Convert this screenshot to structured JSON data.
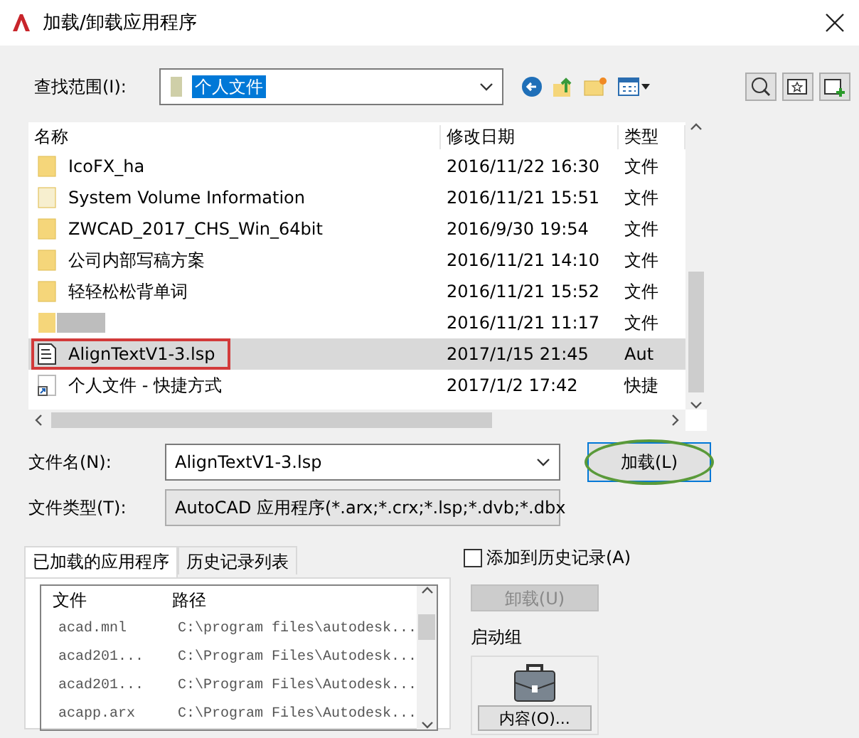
{
  "window": {
    "title": "加载/卸载应用程序"
  },
  "look_in": {
    "label": "查找范围(I):",
    "value": "个人文件"
  },
  "file_list": {
    "columns": [
      "名称",
      "修改日期",
      "类型"
    ],
    "rows": [
      {
        "kind": "folder",
        "name": "IcoFX_ha",
        "date": "2016/11/22 16:30",
        "type": "文件",
        "selected": false,
        "marked": false
      },
      {
        "kind": "hidden-folder",
        "name": "System Volume Information",
        "date": "2016/11/21 15:51",
        "type": "文件",
        "selected": false,
        "marked": false
      },
      {
        "kind": "folder",
        "name": "ZWCAD_2017_CHS_Win_64bit",
        "date": "2016/9/30 19:54",
        "type": "文件",
        "selected": false,
        "marked": false
      },
      {
        "kind": "folder",
        "name": "公司内部写稿方案",
        "date": "2016/11/21 14:10",
        "type": "文件",
        "selected": false,
        "marked": false
      },
      {
        "kind": "folder",
        "name": "轻轻松松背单词",
        "date": "2016/11/21 15:52",
        "type": "文件",
        "selected": false,
        "marked": false
      },
      {
        "kind": "redacted-folder",
        "date": "2016/11/21 11:17",
        "type": "文件",
        "selected": false,
        "marked": false
      },
      {
        "kind": "lisp-file",
        "name": "AlignTextV1-3.lsp",
        "date": "2017/1/15 21:45",
        "type": "Aut",
        "selected": true,
        "marked": true
      },
      {
        "kind": "shortcut",
        "name": "个人文件 - 快捷方式",
        "date": "2017/1/2 17:42",
        "type": "快捷",
        "selected": false,
        "marked": false
      }
    ]
  },
  "file_name": {
    "label": "文件名(N):",
    "value": "AlignTextV1-3.lsp"
  },
  "file_type": {
    "label": "文件类型(T):",
    "value": "AutoCAD 应用程序(*.arx;*.crx;*.lsp;*.dvb;*.dbx"
  },
  "load_button": {
    "label": "加载(L)",
    "circled": true
  },
  "tabs": [
    {
      "label": "已加载的应用程序",
      "selected": true
    },
    {
      "label": "历史记录列表",
      "selected": false
    }
  ],
  "loaded_apps": {
    "columns": [
      "文件",
      "路径"
    ],
    "rows": [
      {
        "file": "acad.mnl",
        "path": "C:\\program files\\autodesk..."
      },
      {
        "file": "acad201...",
        "path": "C:\\Program Files\\Autodesk..."
      },
      {
        "file": "acad201...",
        "path": "C:\\Program Files\\Autodesk..."
      },
      {
        "file": "acapp.arx",
        "path": "C:\\Program Files\\Autodesk..."
      }
    ]
  },
  "add_to_history": {
    "label": "添加到历史记录(A)",
    "checked": false
  },
  "unload_button": {
    "label": "卸载(U)",
    "disabled": true
  },
  "startup_group": {
    "title": "启动组",
    "button": "内容(O)..."
  }
}
